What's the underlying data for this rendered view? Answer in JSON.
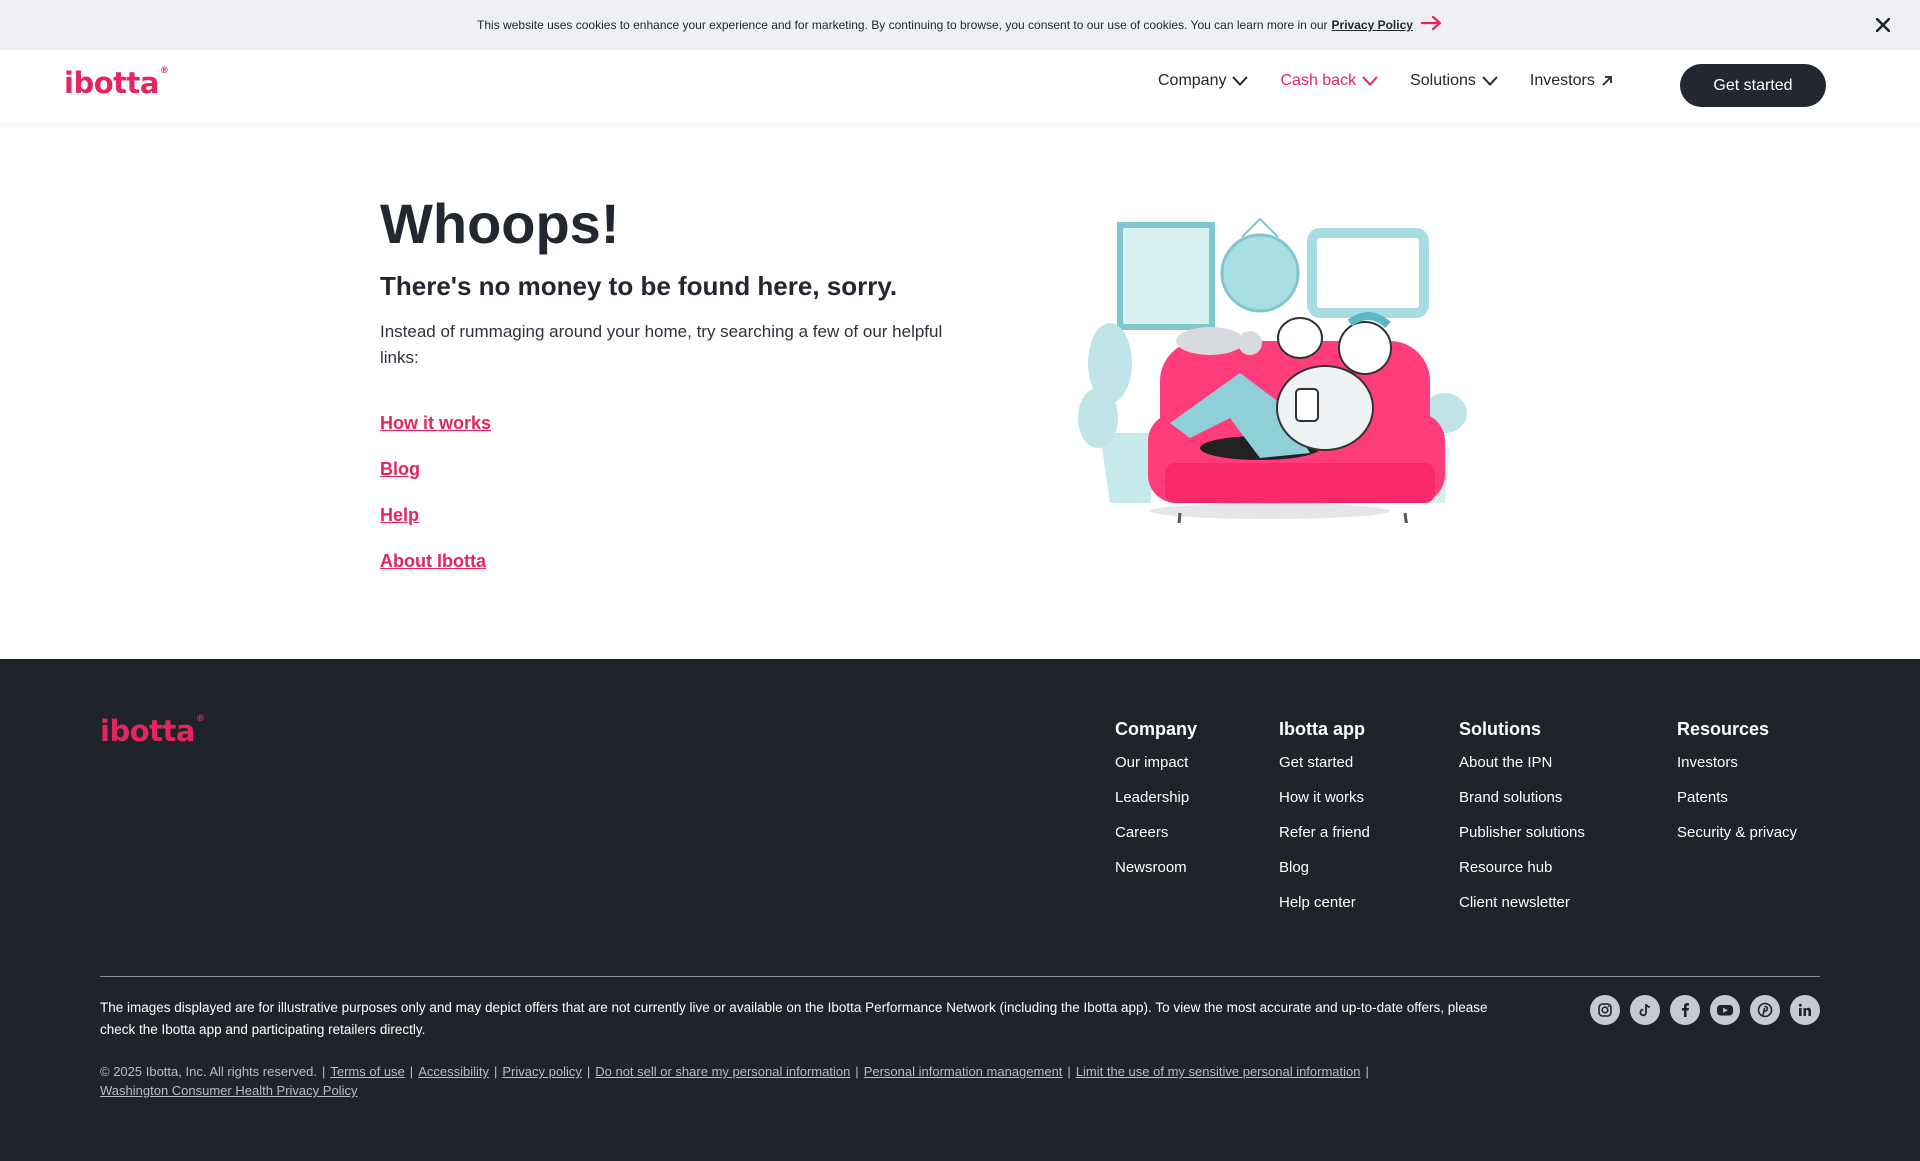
{
  "cookie_bar": {
    "text": "This website uses cookies to enhance your experience and for marketing. By continuing to browse, you consent to our use of cookies. You can learn more in our",
    "link_label": "Privacy Policy"
  },
  "brand": {
    "logo_text": "ibotta",
    "logo_mark": "®",
    "accent_color": "#e6245e",
    "dark_color": "#23272f"
  },
  "nav": {
    "items": [
      {
        "label": "Company",
        "icon": "chevron-down-icon"
      },
      {
        "label": "Cash back",
        "icon": "chevron-down-icon",
        "active": true
      },
      {
        "label": "Solutions",
        "icon": "chevron-down-icon"
      },
      {
        "label": "Investors",
        "icon": "arrow-up-right-icon"
      }
    ],
    "cta_label": "Get started"
  },
  "main": {
    "title": "Whoops!",
    "subtitle": "There's no money to be found here, sorry.",
    "description": "Instead of rummaging around your home, try searching a few of our helpful links:",
    "links": [
      "How it works",
      "Blog",
      "Help",
      "About Ibotta"
    ]
  },
  "footer": {
    "columns": [
      {
        "heading": "Company",
        "links": [
          "Our impact",
          "Leadership",
          "Careers",
          "Newsroom"
        ]
      },
      {
        "heading": "Ibotta app",
        "links": [
          "Get started",
          "How it works",
          "Refer a friend",
          "Blog",
          "Help center"
        ]
      },
      {
        "heading": "Solutions",
        "links": [
          "About the IPN",
          "Brand solutions",
          "Publisher solutions",
          "Resource hub",
          "Client newsletter"
        ]
      },
      {
        "heading": "Resources",
        "links": [
          "Investors",
          "Patents",
          "Security & privacy"
        ]
      }
    ],
    "disclaimer": "The images displayed are for illustrative purposes only and may depict offers that are not currently live or available on the Ibotta Performance Network (including the Ibotta app). To view the most accurate and up-to-date offers, please check the Ibotta app and participating retailers directly.",
    "copyright": "© 2025 Ibotta, Inc. All rights reserved.",
    "legal_links": [
      "Terms of use",
      "Accessibility",
      "Privacy policy",
      "Do not sell or share my personal information",
      "Personal information management",
      "Limit the use of my sensitive personal information",
      "Washington Consumer Health Privacy Policy"
    ],
    "socials": [
      "instagram-icon",
      "tiktok-icon",
      "facebook-icon",
      "youtube-icon",
      "pinterest-icon",
      "linkedin-icon"
    ]
  }
}
